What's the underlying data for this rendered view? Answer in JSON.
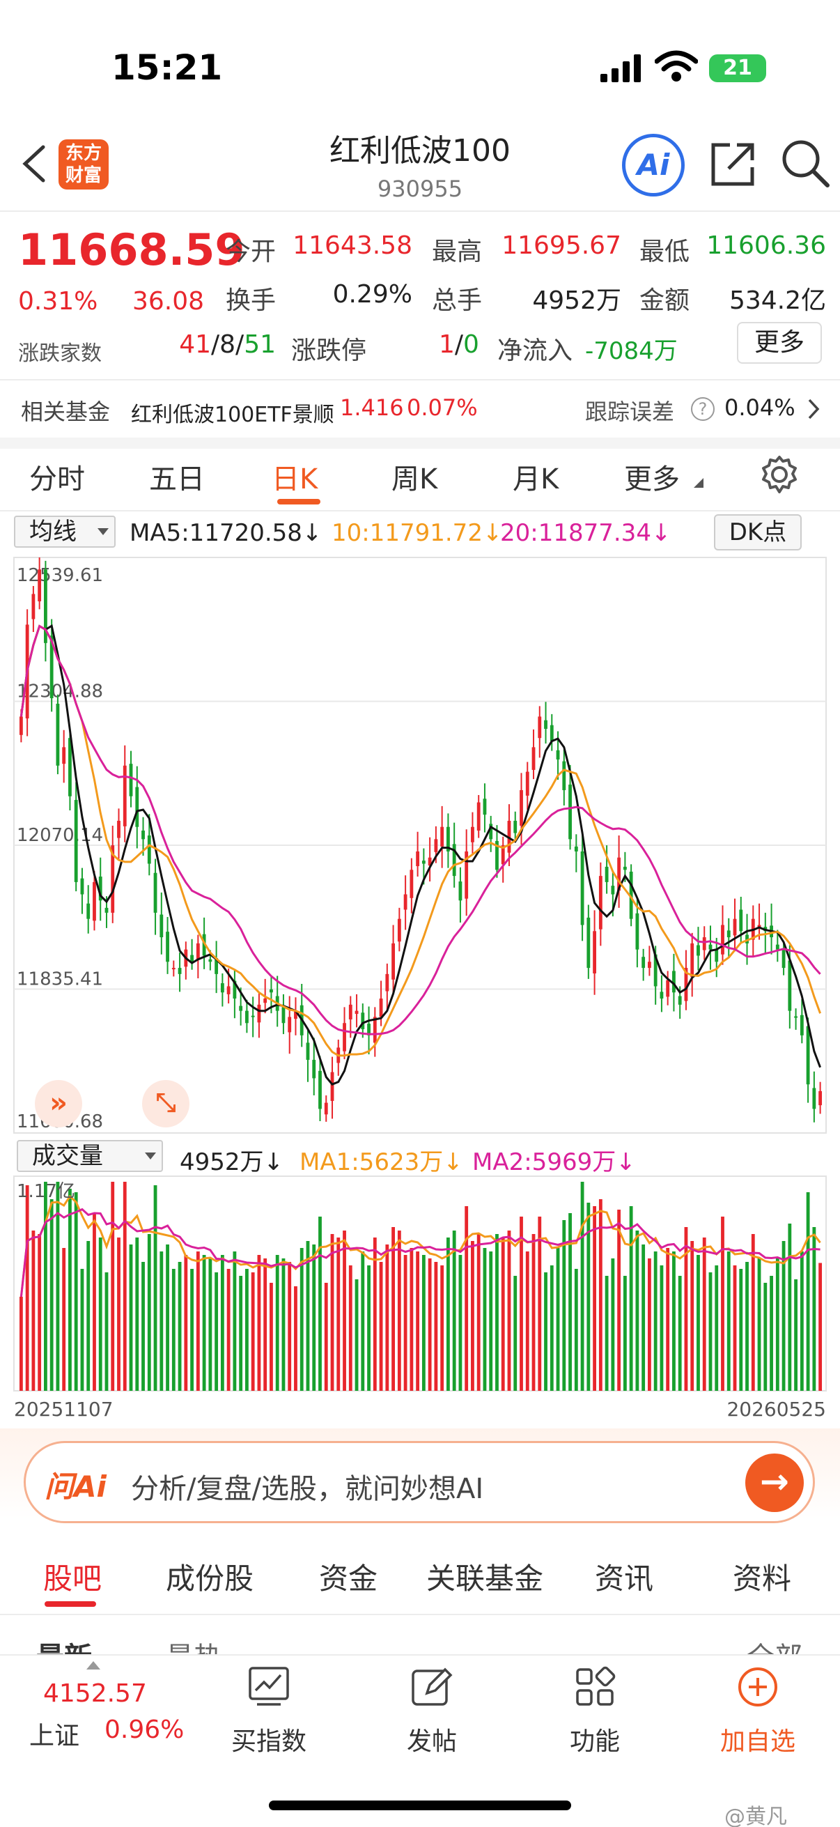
{
  "status": {
    "time": "15:21",
    "battery": "21"
  },
  "header": {
    "logo_line1": "东方",
    "logo_line2": "财富",
    "title": "红利低波100",
    "code": "930955",
    "ai_label": "Ai"
  },
  "quote": {
    "price": "11668.59",
    "change_pct": "0.31%",
    "change_amt": "36.08",
    "open_label": "今开",
    "open": "11643.58",
    "high_label": "最高",
    "high": "11695.67",
    "low_label": "最低",
    "low": "11606.36",
    "turnover_label": "换手",
    "turnover": "0.29%",
    "volume_label": "总手",
    "volume": "4952万",
    "amount_label": "金额",
    "amount": "534.2亿",
    "breadth_label": "涨跌家数",
    "breadth_up": "41",
    "breadth_sep1": "/",
    "breadth_flat": "8",
    "breadth_sep2": "/",
    "breadth_down": "51",
    "limit_label": "涨跌停",
    "limit_up": "1",
    "limit_sep": "/",
    "limit_down": "0",
    "netflow_label": "净流入",
    "netflow": "-7084万",
    "more_label": "更多"
  },
  "fund": {
    "label": "相关基金",
    "name": "红利低波100ETF景顺",
    "price": "1.416",
    "pct": "0.07%",
    "track_label": "跟踪误差",
    "track_value": "0.04%"
  },
  "tabs": [
    "分时",
    "五日",
    "日K",
    "周K",
    "月K",
    "更多"
  ],
  "indicators": {
    "ma_select": "均线",
    "ma5": "MA5:11720.58↓",
    "ma10": "10:11791.72↓",
    "ma20": "20:11877.34↓",
    "dk": "DK点",
    "vol_select": "成交量",
    "vol_value": "4952万↓",
    "vol_ma1": "MA1:5623万↓",
    "vol_ma2": "MA2:5969万↓"
  },
  "colors": {
    "up": "#e8262c",
    "down": "#18a02e",
    "ma5": "#111111",
    "ma10": "#f39a1c",
    "ma20": "#d9219a",
    "accent": "#f05a22"
  },
  "chart_data": {
    "type": "candlestick",
    "y_ticks": [
      "12539.61",
      "12304.88",
      "12070.14",
      "11835.41",
      "11600.68"
    ],
    "ylim": [
      11600.68,
      12539.61
    ],
    "x_start": "20251107",
    "x_end": "20260525",
    "closes": [
      12280,
      12430,
      12480,
      12520,
      12400,
      12310,
      12200,
      12230,
      12150,
      12010,
      11990,
      11950,
      12010,
      11980,
      11960,
      12070,
      12110,
      12200,
      12150,
      12100,
      12080,
      12040,
      11960,
      11920,
      11880,
      11870,
      11860,
      11900,
      11880,
      11910,
      11890,
      11880,
      11860,
      11830,
      11840,
      11820,
      11800,
      11780,
      11790,
      11810,
      11820,
      11830,
      11800,
      11780,
      11790,
      11800,
      11760,
      11720,
      11690,
      11640,
      11650,
      11700,
      11740,
      11780,
      11810,
      11800,
      11770,
      11760,
      11790,
      11820,
      11860,
      11910,
      11950,
      11990,
      12030,
      12060,
      12040,
      12050,
      12080,
      12100,
      12060,
      12020,
      11980,
      12060,
      12100,
      12140,
      12120,
      12080,
      12030,
      12070,
      12110,
      12090,
      12160,
      12190,
      12230,
      12280,
      12260,
      12240,
      12210,
      12160,
      12080,
      12060,
      11940,
      11870,
      11930,
      12020,
      12010,
      11990,
      12050,
      12030,
      11950,
      11900,
      11870,
      11880,
      11840,
      11820,
      11850,
      11830,
      11810,
      11870,
      11910,
      11890,
      11920,
      11900,
      11880,
      11940,
      11920,
      11950,
      11930,
      11910,
      11950,
      11940,
      11930,
      11920,
      11900,
      11870,
      11800,
      11790,
      11760,
      11680,
      11640,
      11669
    ],
    "volume_max_label": "1.17亿",
    "volume_ma1_label": "MA1",
    "volume_ma2_label": "MA2"
  },
  "float": {
    "expand_icon": "»",
    "fullscreen_icon": "⤡"
  },
  "ai": {
    "logo": "问Ai",
    "placeholder": "分析/复盘/选股，就问妙想AI",
    "go": "→"
  },
  "bottom_tabs": [
    "股吧",
    "成份股",
    "资金",
    "关联基金",
    "资讯",
    "资料"
  ],
  "sub_tabs": {
    "latest": "最新",
    "hot": "最热",
    "all": "全部"
  },
  "nav": {
    "index_value": "4152.57",
    "index_name": "上证",
    "index_pct": "0.96%",
    "buy_index": "买指数",
    "post": "发帖",
    "func": "功能",
    "add": "加自选"
  },
  "watermark": "@黄凡"
}
